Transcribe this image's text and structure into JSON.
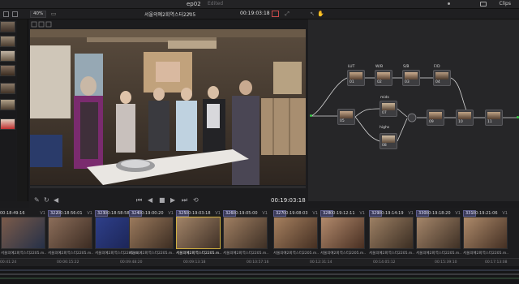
{
  "topbar": {
    "project_title": "ep02",
    "edited_label": "Edited",
    "clips_label": "Clips"
  },
  "viewer_toolbar": {
    "zoom": "40%",
    "clip_name": "서울의예2회역스터2205",
    "timecode": "00:19:03:18"
  },
  "viewer": {
    "timecode": "00:19:03:18"
  },
  "node_graph": {
    "labels": {
      "lut": "LUT",
      "wb": "W/B",
      "sat": "S/B",
      "fd": "F/D",
      "mids": "mids",
      "highs": "highs"
    },
    "nodes": [
      "01",
      "02",
      "03",
      "04",
      "05",
      "07",
      "08",
      "09",
      "10",
      "11"
    ]
  },
  "timeline": {
    "clips": [
      {
        "index": "",
        "timecode": "00:18:49:16",
        "track": "V1",
        "name": "서울의예2회역스터2205.m..."
      },
      {
        "index": "322",
        "timecode": "00:18:56:01",
        "track": "V1",
        "name": "서울의예2회역스터2205.m..."
      },
      {
        "index": "323",
        "timecode": "00:18:58:58",
        "track": "V1",
        "name": "서울의예2회역스터2205.m..."
      },
      {
        "index": "324",
        "timecode": "00:19:00:20",
        "track": "V1",
        "name": "서울의예2회역스터2205.m..."
      },
      {
        "index": "325",
        "timecode": "00:19:03:18",
        "track": "V1",
        "name": "서울의예2회역스터2205.m..."
      },
      {
        "index": "326",
        "timecode": "00:19:05:00",
        "track": "V1",
        "name": "서울의예2회역스터2205.m..."
      },
      {
        "index": "327",
        "timecode": "00:19:08:03",
        "track": "V1",
        "name": "서울의예2회역스터2205.m..."
      },
      {
        "index": "328",
        "timecode": "00:19:12:11",
        "track": "V1",
        "name": "서울의예2회역스터2205.m..."
      },
      {
        "index": "329",
        "timecode": "00:19:14:19",
        "track": "V1",
        "name": "서울의예2회역스터2205.m..."
      },
      {
        "index": "330",
        "timecode": "00:19:18:20",
        "track": "V1",
        "name": "서울의예2회역스터2205.m..."
      },
      {
        "index": "331",
        "timecode": "00:19:21:06",
        "track": "V1",
        "name": "서울의예2회역스터2205.m..."
      }
    ],
    "ruler": [
      "00:41:24",
      "00:06:15:22",
      "00:09:48:20",
      "00:09:13:18",
      "00:10:57:16",
      "00:12:31:14",
      "00:14:05:12",
      "00:15:39:10",
      "00:17:13:08"
    ]
  }
}
